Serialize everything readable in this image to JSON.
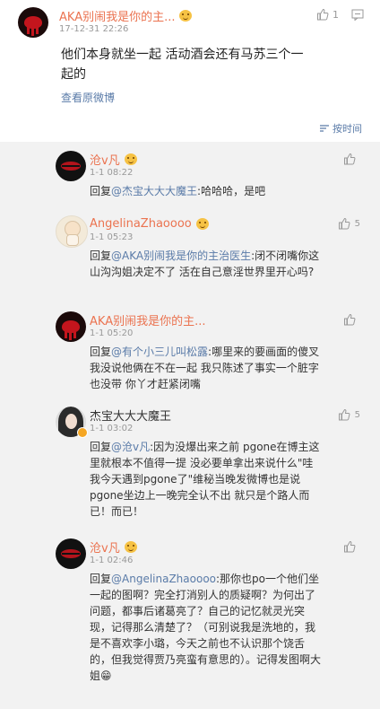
{
  "post": {
    "author": "AKA别闹我是你的主...",
    "time": "17-12-31 22:26",
    "like_count": "1",
    "text": "他们本身就坐一起 活动酒会还有马苏三个一起的",
    "view_original": "查看原微博",
    "sort_label": "按时间"
  },
  "comments": [
    {
      "author": "沧v凡",
      "time": "1-1 08:22",
      "likes": "",
      "reply_prefix": "回复",
      "mention": "@杰宝大大大魔王",
      "text": ":哈哈哈，是吧"
    },
    {
      "author": "AngelinaZhaoooo",
      "time": "1-1 05:23",
      "likes": "5",
      "reply_prefix": "回复",
      "mention": "@AKA别闹我是你的主治医生",
      "text": ":闭不闭嘴你这山沟沟姐决定不了 活在自己意淫世界里开心吗?"
    },
    {
      "author": "AKA别闹我是你的主...",
      "time": "1-1 05:20",
      "likes": "",
      "reply_prefix": "回复",
      "mention": "@有个小三儿叫松露",
      "text": ":哪里来的要画面的傻叉 我没说他俩在不在一起 我只陈述了事实一个脏字也没带 你丫才赶紧闭嘴"
    },
    {
      "author": "杰宝大大大魔王",
      "time": "1-1 03:02",
      "likes": "5",
      "reply_prefix": "回复",
      "mention": "@沧v凡",
      "text": ":因为没爆出来之前 pgone在博主这里就根本不值得一提 没必要单拿出来说什么\"哇我今天遇到pgone了\"维秘当晚发微博也是说pgone坐边上一晚完全认不出 就只是个路人而已！而已！"
    },
    {
      "author": "沧v凡",
      "time": "1-1 02:46",
      "likes": "",
      "reply_prefix": "回复",
      "mention": "@AngelinaZhaoooo",
      "text": ":那你也po一个他们坐一起的图啊？完全打消别人的质疑啊？为何出了问题，都事后诸葛亮了？自己的记忆就灵光突现，记得那么清楚了？（可别说我是洗地的，我是不喜欢李小璐，今天之前也不认识那个饶舌的，但我觉得贾乃亮蛮有意思的）。记得发图啊大姐😁"
    }
  ],
  "colors": {
    "link": "#5a7ba8",
    "username_orange": "#eb7350",
    "background": "#f2f2f2"
  }
}
